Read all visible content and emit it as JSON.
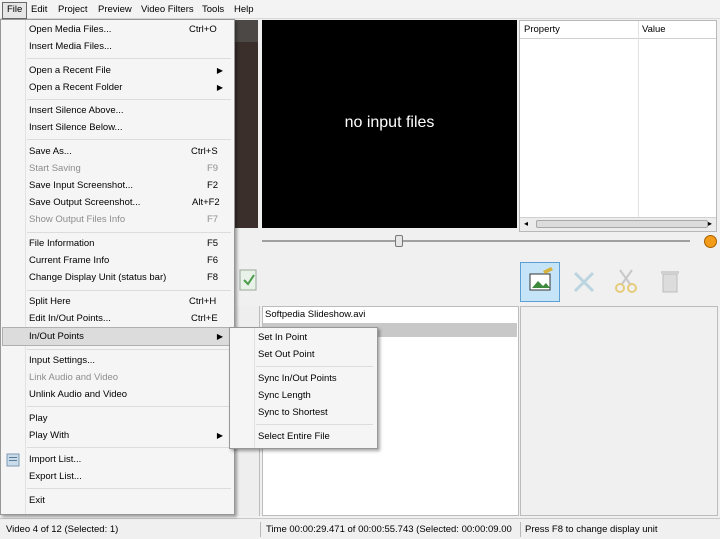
{
  "menubar": [
    "File",
    "Edit",
    "Project",
    "Preview",
    "Video Filters",
    "Tools",
    "Help"
  ],
  "video": {
    "message": "no input files"
  },
  "properties": {
    "col_property": "Property",
    "col_value": "Value"
  },
  "file_list": {
    "items": [
      "Softpedia Slideshow.avi"
    ]
  },
  "file_menu": {
    "open_media": {
      "label": "Open Media Files...",
      "shortcut": "Ctrl+O"
    },
    "insert_media": {
      "label": "Insert Media Files..."
    },
    "open_recent_file": {
      "label": "Open a Recent File"
    },
    "open_recent_folder": {
      "label": "Open a Recent Folder"
    },
    "insert_silence_above": {
      "label": "Insert Silence Above..."
    },
    "insert_silence_below": {
      "label": "Insert Silence Below..."
    },
    "save_as": {
      "label": "Save As...",
      "shortcut": "Ctrl+S"
    },
    "start_saving": {
      "label": "Start Saving",
      "shortcut": "F9"
    },
    "save_input_screenshot": {
      "label": "Save Input Screenshot...",
      "shortcut": "F2"
    },
    "save_output_screenshot": {
      "label": "Save Output Screenshot...",
      "shortcut": "Alt+F2"
    },
    "show_output_files": {
      "label": "Show Output Files Info",
      "shortcut": "F7"
    },
    "file_information": {
      "label": "File Information",
      "shortcut": "F5"
    },
    "current_frame_info": {
      "label": "Current Frame Info",
      "shortcut": "F6"
    },
    "change_display_unit": {
      "label": "Change Display Unit (status bar)",
      "shortcut": "F8"
    },
    "split_here": {
      "label": "Split Here",
      "shortcut": "Ctrl+H"
    },
    "edit_inout": {
      "label": "Edit In/Out Points...",
      "shortcut": "Ctrl+E"
    },
    "inout_points": {
      "label": "In/Out Points"
    },
    "input_settings": {
      "label": "Input Settings..."
    },
    "link_audio_video": {
      "label": "Link Audio and Video"
    },
    "unlink_audio_video": {
      "label": "Unlink Audio and Video"
    },
    "play": {
      "label": "Play"
    },
    "play_with": {
      "label": "Play With"
    },
    "import_list": {
      "label": "Import List..."
    },
    "export_list": {
      "label": "Export List..."
    },
    "exit": {
      "label": "Exit"
    }
  },
  "submenu": [
    "Set In Point",
    "Set Out Point",
    "Sync In/Out Points",
    "Sync Length",
    "Sync to Shortest",
    "Select Entire File"
  ],
  "status": {
    "video": "Video 4 of 12  (Selected: 1)",
    "time": "Time 00:00:29.471 of 00:00:55.743  (Selected: 00:00:09.00",
    "hint": "Press F8 to change display unit"
  }
}
